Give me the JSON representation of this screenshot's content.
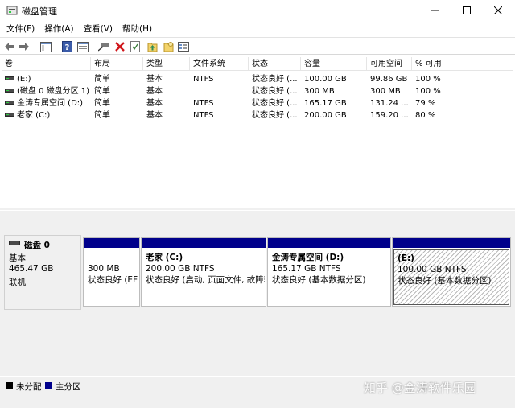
{
  "window": {
    "title": "磁盘管理",
    "controls": {
      "minimize": "—",
      "maximize": "☐",
      "close": "✕"
    }
  },
  "menu": [
    "文件(F)",
    "操作(A)",
    "查看(V)",
    "帮助(H)"
  ],
  "toolbar": {
    "icons": [
      "back-icon",
      "forward-icon",
      "console-tree-icon",
      "help-icon",
      "properties-view-icon",
      "connect-icon",
      "delete-icon",
      "check-icon",
      "up-icon",
      "folder-icon",
      "list-view-icon"
    ]
  },
  "table": {
    "headers": [
      "卷",
      "布局",
      "类型",
      "文件系统",
      "状态",
      "容量",
      "可用空间",
      "% 可用"
    ],
    "rows": [
      {
        "volume": "(E:)",
        "layout": "简单",
        "type": "基本",
        "fs": "NTFS",
        "status": "状态良好 (...",
        "capacity": "100.00 GB",
        "free": "99.86 GB",
        "pct": "100 %"
      },
      {
        "volume": "(磁盘 0 磁盘分区 1)",
        "layout": "简单",
        "type": "基本",
        "fs": "",
        "status": "状态良好 (...",
        "capacity": "300 MB",
        "free": "300 MB",
        "pct": "100 %"
      },
      {
        "volume": "金涛专属空间 (D:)",
        "layout": "简单",
        "type": "基本",
        "fs": "NTFS",
        "status": "状态良好 (...",
        "capacity": "165.17 GB",
        "free": "131.24 ...",
        "pct": "79 %"
      },
      {
        "volume": "老家 (C:)",
        "layout": "简单",
        "type": "基本",
        "fs": "NTFS",
        "status": "状态良好 (...",
        "capacity": "200.00 GB",
        "free": "159.20 ...",
        "pct": "80 %"
      }
    ]
  },
  "disk": {
    "name": "磁盘 0",
    "type": "基本",
    "size": "465.47 GB",
    "state": "联机"
  },
  "partitions": [
    {
      "title": "",
      "size": "300 MB",
      "status": "状态良好 (EF"
    },
    {
      "title": "老家  (C:)",
      "size": "200.00 GB NTFS",
      "status": "状态良好 (启动, 页面文件, 故障转"
    },
    {
      "title": "金涛专属空间  (D:)",
      "size": "165.17 GB NTFS",
      "status": "状态良好 (基本数据分区)"
    },
    {
      "title": "(E:)",
      "size": "100.00 GB NTFS",
      "status": "状态良好 (基本数据分区)"
    }
  ],
  "legend": {
    "unallocated": "未分配",
    "primary": "主分区",
    "colors": {
      "unallocated": "#000000",
      "primary": "#00008b"
    }
  },
  "watermark": "知乎 @金涛软件乐园"
}
